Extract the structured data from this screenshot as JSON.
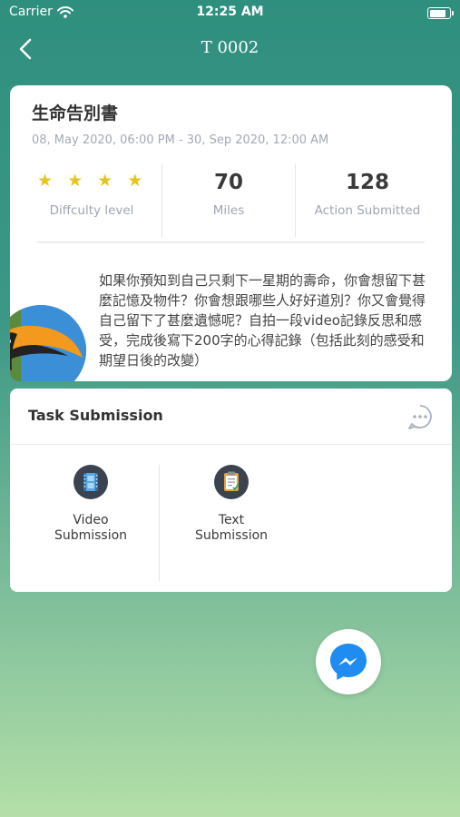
{
  "status_bar": {
    "carrier": "Carrier",
    "time": "12:25 AM",
    "battery_level": 0.95
  },
  "nav": {
    "title": "T 0002"
  },
  "task": {
    "title": "生命告別書",
    "date_range": "08, May 2020, 06:00 PM - 30, Sep 2020, 12:00 AM",
    "difficulty": {
      "stars": "★ ★ ★ ★",
      "rating": 4,
      "label": "Diffculty level"
    },
    "miles": {
      "value": "70",
      "label": "Miles"
    },
    "action_submitted": {
      "value": "128",
      "label": "Action Submitted"
    },
    "description": "如果你預知到自己只剩下一星期的壽命，你會想留下甚麼記憶及物件？你會想跟哪些人好好道別？你又會覺得自己留下了甚麼遺憾呢？自拍一段video記錄反思和感受，完成後寫下200字的心得記錄（包括此刻的感受和期望日後的改變）"
  },
  "submission": {
    "header": "Task Submission",
    "options": [
      {
        "label": "Video\nSubmission",
        "icon": "film-icon"
      },
      {
        "label": "Text\nSubmission",
        "icon": "clipboard-icon"
      }
    ]
  },
  "colors": {
    "accent_star": "#e8c51b",
    "icon_bg": "#3b4250",
    "messenger_blue": "#1e8cf0"
  }
}
